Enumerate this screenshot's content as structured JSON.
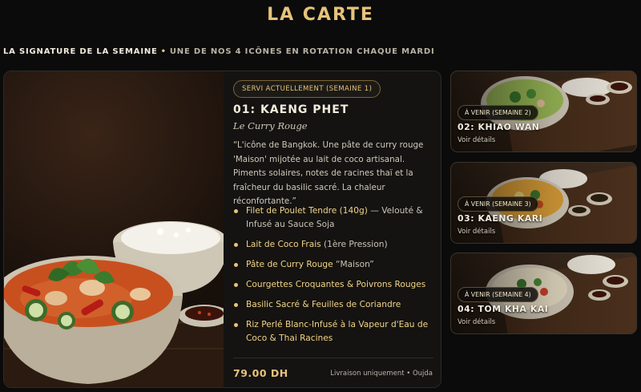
{
  "page": {
    "title": "LA CARTE",
    "subtitle_lead": "LA SIGNATURE DE LA SEMAINE",
    "subtitle_separator": "•",
    "subtitle_rest": "UNE DE NOS 4 ICÔNES EN ROTATION CHAQUE MARDI"
  },
  "featured": {
    "status": "SERVI ACTUELLEMENT (SEMAINE 1)",
    "title": "01: KAENG PHET",
    "subtitle": "Le Curry Rouge",
    "description": "“L'icône de Bangkok. Une pâte de curry rouge 'Maison' mijotée au lait de coco artisanal. Piments solaires, notes de racines thaï et la fraîcheur du basilic sacré. La chaleur réconfortante.”",
    "ingredients": [
      {
        "highlight": "Filet de Poulet Tendre (140g)",
        "rest": " — Velouté & Infusé au Sauce Soja"
      },
      {
        "highlight": "Lait de Coco Frais",
        "rest": " (1ère Pression)"
      },
      {
        "highlight": "Pâte de Curry Rouge",
        "rest": " “Maison”"
      },
      {
        "highlight": "Courgettes Croquantes & Poivrons Rouges",
        "rest": ""
      },
      {
        "highlight": "Basilic Sacré & Feuilles de Coriandre",
        "rest": ""
      },
      {
        "highlight": "Riz Perlé Blanc-Infusé à la Vapeur d'Eau de Coco & Thai Racines",
        "rest": ""
      }
    ],
    "price": "79.00 DH",
    "delivery_note": "Livraison uniquement • Oujda"
  },
  "upcoming": [
    {
      "badge": "À VENIR (SEMAINE 2)",
      "title": "02: KHIAO WAN",
      "link": "Voir détails",
      "curry_color": "#9fbf5a"
    },
    {
      "badge": "À VENIR (SEMAINE 3)",
      "title": "03: KAENG KARI",
      "link": "Voir détails",
      "curry_color": "#e0a23a"
    },
    {
      "badge": "À VENIR (SEMAINE 4)",
      "title": "04: TOM KHA KAI",
      "link": "Voir détails",
      "curry_color": "#ece1c8"
    }
  ],
  "colors": {
    "accent_gold": "#e7c27a",
    "background": "#0b0b0b",
    "red_curry": "#c8501f"
  },
  "icons": [
    "bullet-dot-icon"
  ]
}
